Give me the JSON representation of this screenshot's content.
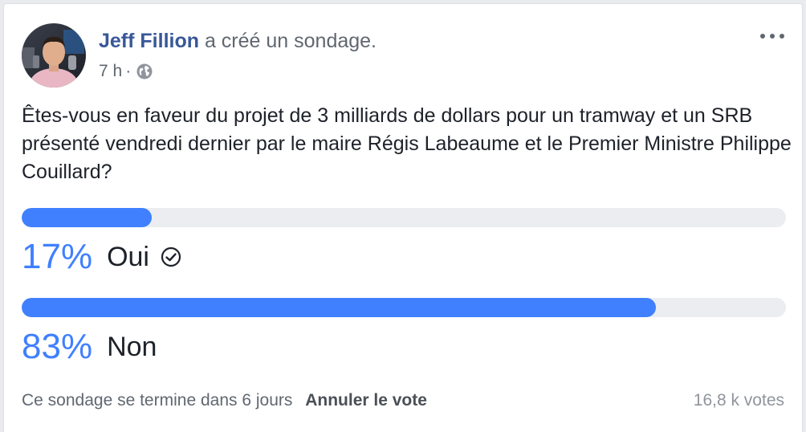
{
  "post": {
    "author": "Jeff Fillion",
    "action": "a créé un sondage.",
    "time": "7 h",
    "separator": "·",
    "privacy_icon": "globe-icon",
    "more_icon": "more-options-icon"
  },
  "poll": {
    "question": "Êtes-vous en faveur du projet de 3 milliards de dollars pour un tramway et un SRB présenté vendredi dernier par le maire Régis Labeaume et le Premier Ministre Philippe Couillard?",
    "options": [
      {
        "percent_label": "17%",
        "percent_value": 17,
        "label": "Oui",
        "selected": true
      },
      {
        "percent_label": "83%",
        "percent_value": 83,
        "label": "Non",
        "selected": false
      }
    ],
    "footer_text": "Ce sondage se termine dans 6 jours",
    "cancel_label": "Annuler le vote",
    "votes": "16,8 k votes"
  },
  "colors": {
    "accent": "#4080ff",
    "author_link": "#385898",
    "track": "#ebedf0"
  }
}
